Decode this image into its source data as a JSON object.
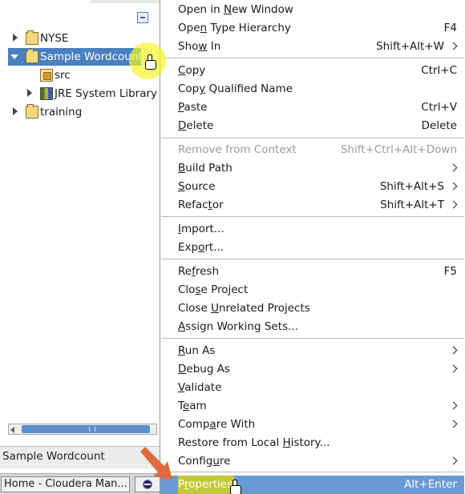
{
  "explorer": {
    "tree": [
      {
        "label": "NYSE",
        "expanded": false,
        "icon": "project-folder-icon"
      },
      {
        "label": "Sample Wordcount",
        "expanded": true,
        "selected": true,
        "icon": "project-folder-icon"
      },
      {
        "label": "src",
        "icon": "package-folder-icon"
      },
      {
        "label": "JRE System Library [",
        "expanded": false,
        "icon": "library-icon"
      },
      {
        "label": "training",
        "expanded": false,
        "icon": "project-folder-icon"
      }
    ],
    "scrollbar_grip": "III"
  },
  "status_bar": {
    "text": "Sample Wordcount"
  },
  "taskbar": {
    "home_task": "Home - Cloudera Man..."
  },
  "context_menu": {
    "items": [
      {
        "pre": "Open in ",
        "u": "N",
        "post": "ew Window",
        "shortcut": ""
      },
      {
        "pre": "Ope",
        "u": "n",
        "post": " Type Hierarchy",
        "shortcut": "F4"
      },
      {
        "pre": "Sho",
        "u": "w",
        "post": " In",
        "shortcut": "Shift+Alt+W",
        "submenu": true
      },
      {
        "pre": "",
        "u": "C",
        "post": "opy",
        "shortcut": "Ctrl+C"
      },
      {
        "pre": "Cop",
        "u": "y",
        "post": " Qualified Name",
        "shortcut": ""
      },
      {
        "pre": "",
        "u": "P",
        "post": "aste",
        "shortcut": "Ctrl+V"
      },
      {
        "pre": "",
        "u": "D",
        "post": "elete",
        "shortcut": "Delete"
      },
      {
        "pre": "Remove from Context",
        "u": "",
        "post": "",
        "shortcut": "Shift+Ctrl+Alt+Down",
        "disabled": true
      },
      {
        "pre": "",
        "u": "B",
        "post": "uild Path",
        "shortcut": "",
        "submenu": true
      },
      {
        "pre": "",
        "u": "S",
        "post": "ource",
        "shortcut": "Shift+Alt+S",
        "submenu": true
      },
      {
        "pre": "Refac",
        "u": "t",
        "post": "or",
        "shortcut": "Shift+Alt+T",
        "submenu": true
      },
      {
        "pre": "",
        "u": "I",
        "post": "mport...",
        "shortcut": ""
      },
      {
        "pre": "Exp",
        "u": "o",
        "post": "rt...",
        "shortcut": ""
      },
      {
        "pre": "Re",
        "u": "f",
        "post": "resh",
        "shortcut": "F5"
      },
      {
        "pre": "Clo",
        "u": "s",
        "post": "e Project",
        "shortcut": ""
      },
      {
        "pre": "Close ",
        "u": "U",
        "post": "nrelated Projects",
        "shortcut": ""
      },
      {
        "pre": "",
        "u": "A",
        "post": "ssign Working Sets...",
        "shortcut": ""
      },
      {
        "pre": "",
        "u": "R",
        "post": "un As",
        "shortcut": "",
        "submenu": true
      },
      {
        "pre": "",
        "u": "D",
        "post": "ebug As",
        "shortcut": "",
        "submenu": true
      },
      {
        "pre": "",
        "u": "V",
        "post": "alidate",
        "shortcut": ""
      },
      {
        "pre": "T",
        "u": "e",
        "post": "am",
        "shortcut": "",
        "submenu": true
      },
      {
        "pre": "Comp",
        "u": "a",
        "post": "re With",
        "shortcut": "",
        "submenu": true
      },
      {
        "pre": "Restore from Local ",
        "u": "H",
        "post": "istory...",
        "shortcut": ""
      },
      {
        "pre": "Config",
        "u": "u",
        "post": "re",
        "shortcut": "",
        "submenu": true
      },
      {
        "pre": "P",
        "u": "r",
        "post": "operties",
        "shortcut": "Alt+Enter",
        "highlighted": true
      }
    ]
  },
  "colors": {
    "selection": "#4a7fc0",
    "menu_highlight": "#6a9ad6",
    "click_halo": "#f5f528",
    "pointer_arrow": "#e06a3a"
  }
}
